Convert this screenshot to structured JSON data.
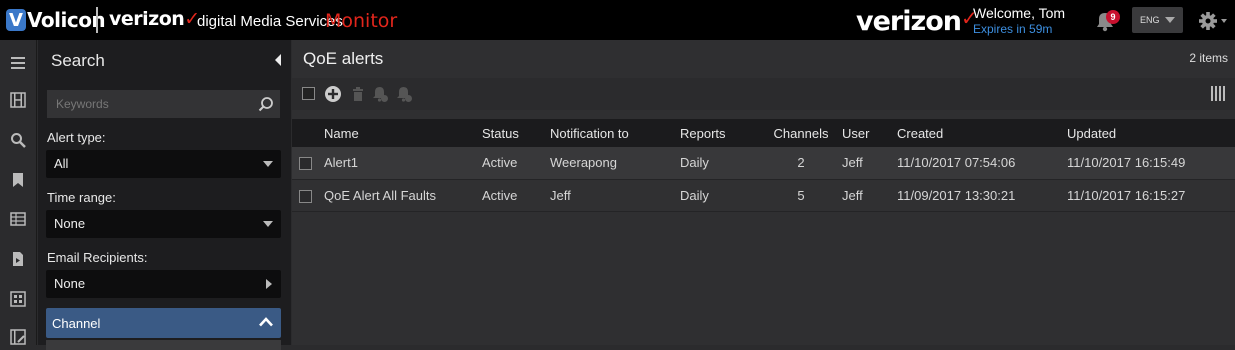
{
  "header": {
    "volicon_logo": "Volicon",
    "vz_logo": "verizon",
    "product_name": "digital Media Services",
    "module": "Monitor",
    "brand_right": "verizon",
    "welcome": "Welcome, Tom",
    "expires": "Expires in 59m",
    "notification_count": "9",
    "language": "ENG",
    "accent_color": "#e1261c",
    "link_color": "#3d8fe0"
  },
  "rail": {
    "icons": [
      "menu-icon",
      "film-icon",
      "search-icon",
      "bookmark-icon",
      "table-icon",
      "document-play-icon",
      "grid-icon",
      "film-edit-icon"
    ]
  },
  "search": {
    "title": "Search",
    "keywords_placeholder": "Keywords",
    "alert_type_label": "Alert type:",
    "alert_type_value": "All",
    "time_range_label": "Time range:",
    "time_range_value": "None",
    "email_label": "Email Recipients:",
    "email_value": "None",
    "channel_label": "Channel"
  },
  "main": {
    "title": "QoE alerts",
    "item_count": "2 items",
    "columns": [
      "Name",
      "Status",
      "Notification to",
      "Reports",
      "Channels",
      "User",
      "Created",
      "Updated"
    ],
    "rows": [
      [
        "Alert1",
        "Active",
        "Weerapong",
        "Daily",
        "2",
        "Jeff",
        "11/10/2017 07:54:06",
        "11/10/2017 16:15:49"
      ],
      [
        "QoE Alert All Faults",
        "Active",
        "Jeff",
        "Daily",
        "5",
        "Jeff",
        "11/09/2017 13:30:21",
        "11/10/2017 16:15:27"
      ]
    ]
  }
}
